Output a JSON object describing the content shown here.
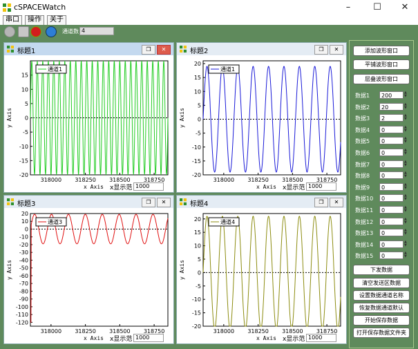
{
  "app": {
    "title": "cSPACEWatch"
  },
  "window_controls": {
    "minimize": "–",
    "maximize": "☐",
    "close": "✕"
  },
  "menu": [
    "串口",
    "操作",
    "关于"
  ],
  "toolbar": {
    "channel_label": "通道数",
    "channel_value": "4"
  },
  "colors": {
    "bg": "#5f8a5c",
    "ch1": "#22cc22",
    "ch2": "#1a1ad8",
    "ch3": "#e01010",
    "ch4": "#8c8c10"
  },
  "icons": [
    "app-icon",
    "connect-icon",
    "settings-icon",
    "stop-icon",
    "refresh-icon",
    "window-icon"
  ],
  "panels": [
    {
      "title": "标题1",
      "legend": "通道1",
      "xlabel": "x Axis",
      "ylabel": "y Axis",
      "range_label": "x显示范",
      "range_value": "1000",
      "active": true
    },
    {
      "title": "标题2",
      "legend": "通道1",
      "xlabel": "x Axis",
      "ylabel": "y Axis",
      "range_label": "x显示范",
      "range_value": "1000",
      "active": false
    },
    {
      "title": "标题3",
      "legend": "通道3",
      "xlabel": "x Axis",
      "ylabel": "y Axis",
      "range_label": "x显示范",
      "range_value": "1000",
      "active": false
    },
    {
      "title": "标题4",
      "legend": "通道4",
      "xlabel": "x Axis",
      "ylabel": "y Axis",
      "range_label": "x显示范",
      "range_value": "1000",
      "active": false
    }
  ],
  "right_panel": {
    "buttons_top": [
      "添加波形窗口",
      "平铺波形窗口",
      "层叠波形窗口"
    ],
    "data_rows": [
      {
        "label": "数据1",
        "value": "200"
      },
      {
        "label": "数据2",
        "value": "20"
      },
      {
        "label": "数据3",
        "value": "2"
      },
      {
        "label": "数据4",
        "value": "0"
      },
      {
        "label": "数据5",
        "value": "0"
      },
      {
        "label": "数据6",
        "value": "0"
      },
      {
        "label": "数据7",
        "value": "0"
      },
      {
        "label": "数据8",
        "value": "0"
      },
      {
        "label": "数据9",
        "value": "0"
      },
      {
        "label": "数据10",
        "value": "0"
      },
      {
        "label": "数据11",
        "value": "0"
      },
      {
        "label": "数据12",
        "value": "0"
      },
      {
        "label": "数据13",
        "value": "0"
      },
      {
        "label": "数据14",
        "value": "0"
      },
      {
        "label": "数据15",
        "value": "0"
      }
    ],
    "buttons_bottom": [
      "下发数据",
      "清空发送区数据",
      "设置数据通道名称",
      "恢复数据通道默认",
      "开始保存数据",
      "打开保存数据文件夹"
    ]
  },
  "chart_data": [
    {
      "type": "line",
      "series": [
        {
          "name": "通道1",
          "color": "#22cc22",
          "period": 40
        }
      ],
      "xlim": [
        317850,
        318850
      ],
      "ylim": [
        -20,
        20
      ],
      "x_ticks": [
        318000,
        318250,
        318500,
        318750
      ],
      "y_ticks": [
        -20,
        -15,
        -10,
        -5,
        0,
        5,
        10,
        15
      ],
      "amplitude": 20,
      "xlabel": "x Axis",
      "ylabel": "y Axis"
    },
    {
      "type": "line",
      "series": [
        {
          "name": "通道1",
          "color": "#1a1ad8",
          "period": 112
        }
      ],
      "xlim": [
        317850,
        318850
      ],
      "ylim": [
        -20,
        21
      ],
      "x_ticks": [
        318000,
        318250,
        318500,
        318750
      ],
      "y_ticks": [
        -20,
        -15,
        -10,
        -5,
        0,
        5,
        10,
        15,
        20
      ],
      "amplitude": 19,
      "xlabel": "x Axis",
      "ylabel": "y Axis"
    },
    {
      "type": "line",
      "series": [
        {
          "name": "通道3",
          "color": "#e01010",
          "period": 123
        }
      ],
      "xlim": [
        317850,
        318850
      ],
      "ylim": [
        -125,
        20
      ],
      "x_ticks": [
        318000,
        318250,
        318500,
        318750
      ],
      "y_ticks": [
        -120,
        -110,
        -100,
        -90,
        -80,
        -70,
        -60,
        -50,
        -40,
        -30,
        -20,
        -10,
        0,
        10,
        20
      ],
      "amplitude": 19,
      "center": 0,
      "dip": -120,
      "xlabel": "x Axis",
      "ylabel": "y Axis"
    },
    {
      "type": "line",
      "series": [
        {
          "name": "通道4",
          "color": "#8c8c10",
          "period": 112
        }
      ],
      "xlim": [
        317850,
        318850
      ],
      "ylim": [
        -20,
        22
      ],
      "x_ticks": [
        318000,
        318250,
        318500,
        318750
      ],
      "y_ticks": [
        -20,
        -15,
        -10,
        -5,
        0,
        5,
        10,
        15,
        20
      ],
      "amplitude": 21,
      "xlabel": "x Axis",
      "ylabel": "y Axis"
    }
  ]
}
